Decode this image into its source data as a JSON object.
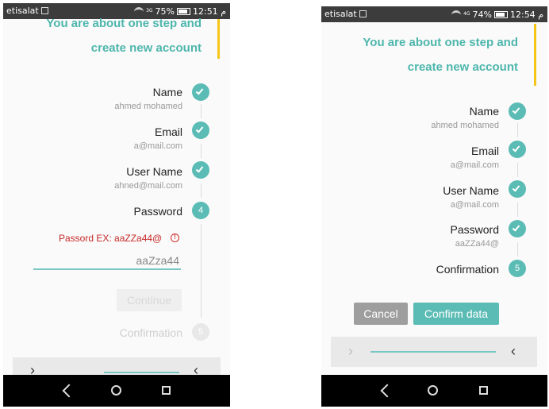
{
  "left": {
    "status": {
      "carrier": "etisalat",
      "network": "3G",
      "battery": "75%",
      "time": "12:51",
      "ampm": "م"
    },
    "header": {
      "line1": "You are about one step and",
      "line2": "create new account"
    },
    "steps": [
      {
        "title": "Name",
        "value": "ahmed mohamed",
        "state": "done"
      },
      {
        "title": "Email",
        "value": "a@mail.com",
        "state": "done"
      },
      {
        "title": "User Name",
        "value": "ahned@mail.com",
        "state": "done"
      },
      {
        "title": "Password",
        "number": "4",
        "state": "active"
      },
      {
        "title": "Confirmation",
        "number": "5",
        "state": "disabled"
      }
    ],
    "password_error": "Passord EX: aaZZa44@",
    "password_input": "aaZza44",
    "continue_label": "Continue",
    "nav": {
      "next": "›",
      "prev": "‹"
    }
  },
  "right": {
    "status": {
      "carrier": "etisalat",
      "network": "4G",
      "battery": "74%",
      "time": "12:54",
      "ampm": "م"
    },
    "header": {
      "line1": "You are about one step and",
      "line2": "create new account"
    },
    "steps": [
      {
        "title": "Name",
        "value": "ahmed mohamed",
        "state": "done"
      },
      {
        "title": "Email",
        "value": "a@mail.com",
        "state": "done"
      },
      {
        "title": "User Name",
        "value": "a@mail.com",
        "state": "done"
      },
      {
        "title": "Password",
        "value": "aaZZa44@",
        "state": "done"
      },
      {
        "title": "Confirmation",
        "number": "5",
        "state": "active"
      }
    ],
    "cancel_label": "Cancel",
    "confirm_label": "Confirm data",
    "nav": {
      "next": "›",
      "prev": "‹"
    }
  },
  "colors": {
    "accent": "#5bbcb5",
    "header": "#4db6ac",
    "error": "#c62828",
    "bar": "#f5c518"
  }
}
